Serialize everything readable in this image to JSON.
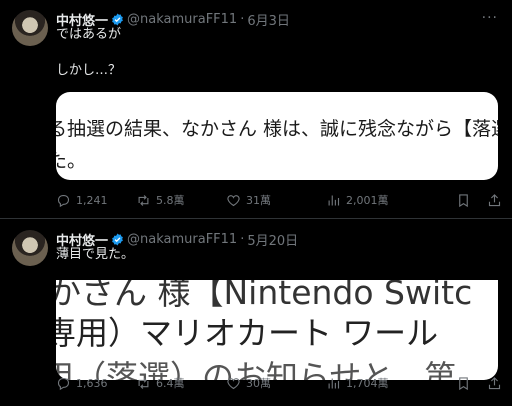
{
  "tweets": [
    {
      "author": "中村悠一",
      "handle": "@nakamuraFF11",
      "date": "6月3日",
      "lines": [
        "ではあるが",
        "しかし…？"
      ],
      "card": {
        "line1": "る抽選の結果、なかさん 様は、誠に残念ながら【落選】",
        "line2": "た。"
      },
      "stats": {
        "replies": "1,241",
        "retweets": "5.8萬",
        "likes": "31萬",
        "views": "2,001萬"
      }
    },
    {
      "author": "中村悠一",
      "handle": "@nakamuraFF11",
      "date": "5月20日",
      "lines": [
        "薄目で見た。"
      ],
      "card": {
        "line1": "かさん 様【Nintendo Switc",
        "line2": "専用）マリオカート ワール",
        "line3": "用（落選）のお知らせと、第"
      },
      "stats": {
        "replies": "1,636",
        "retweets": "6.4萬",
        "likes": "30萬",
        "views": "1,704萬"
      }
    }
  ],
  "ui": {
    "more": "···",
    "separator": "·"
  },
  "colors": {
    "verified": "#1d9bf0",
    "muted": "#71767b",
    "background": "#000000"
  }
}
